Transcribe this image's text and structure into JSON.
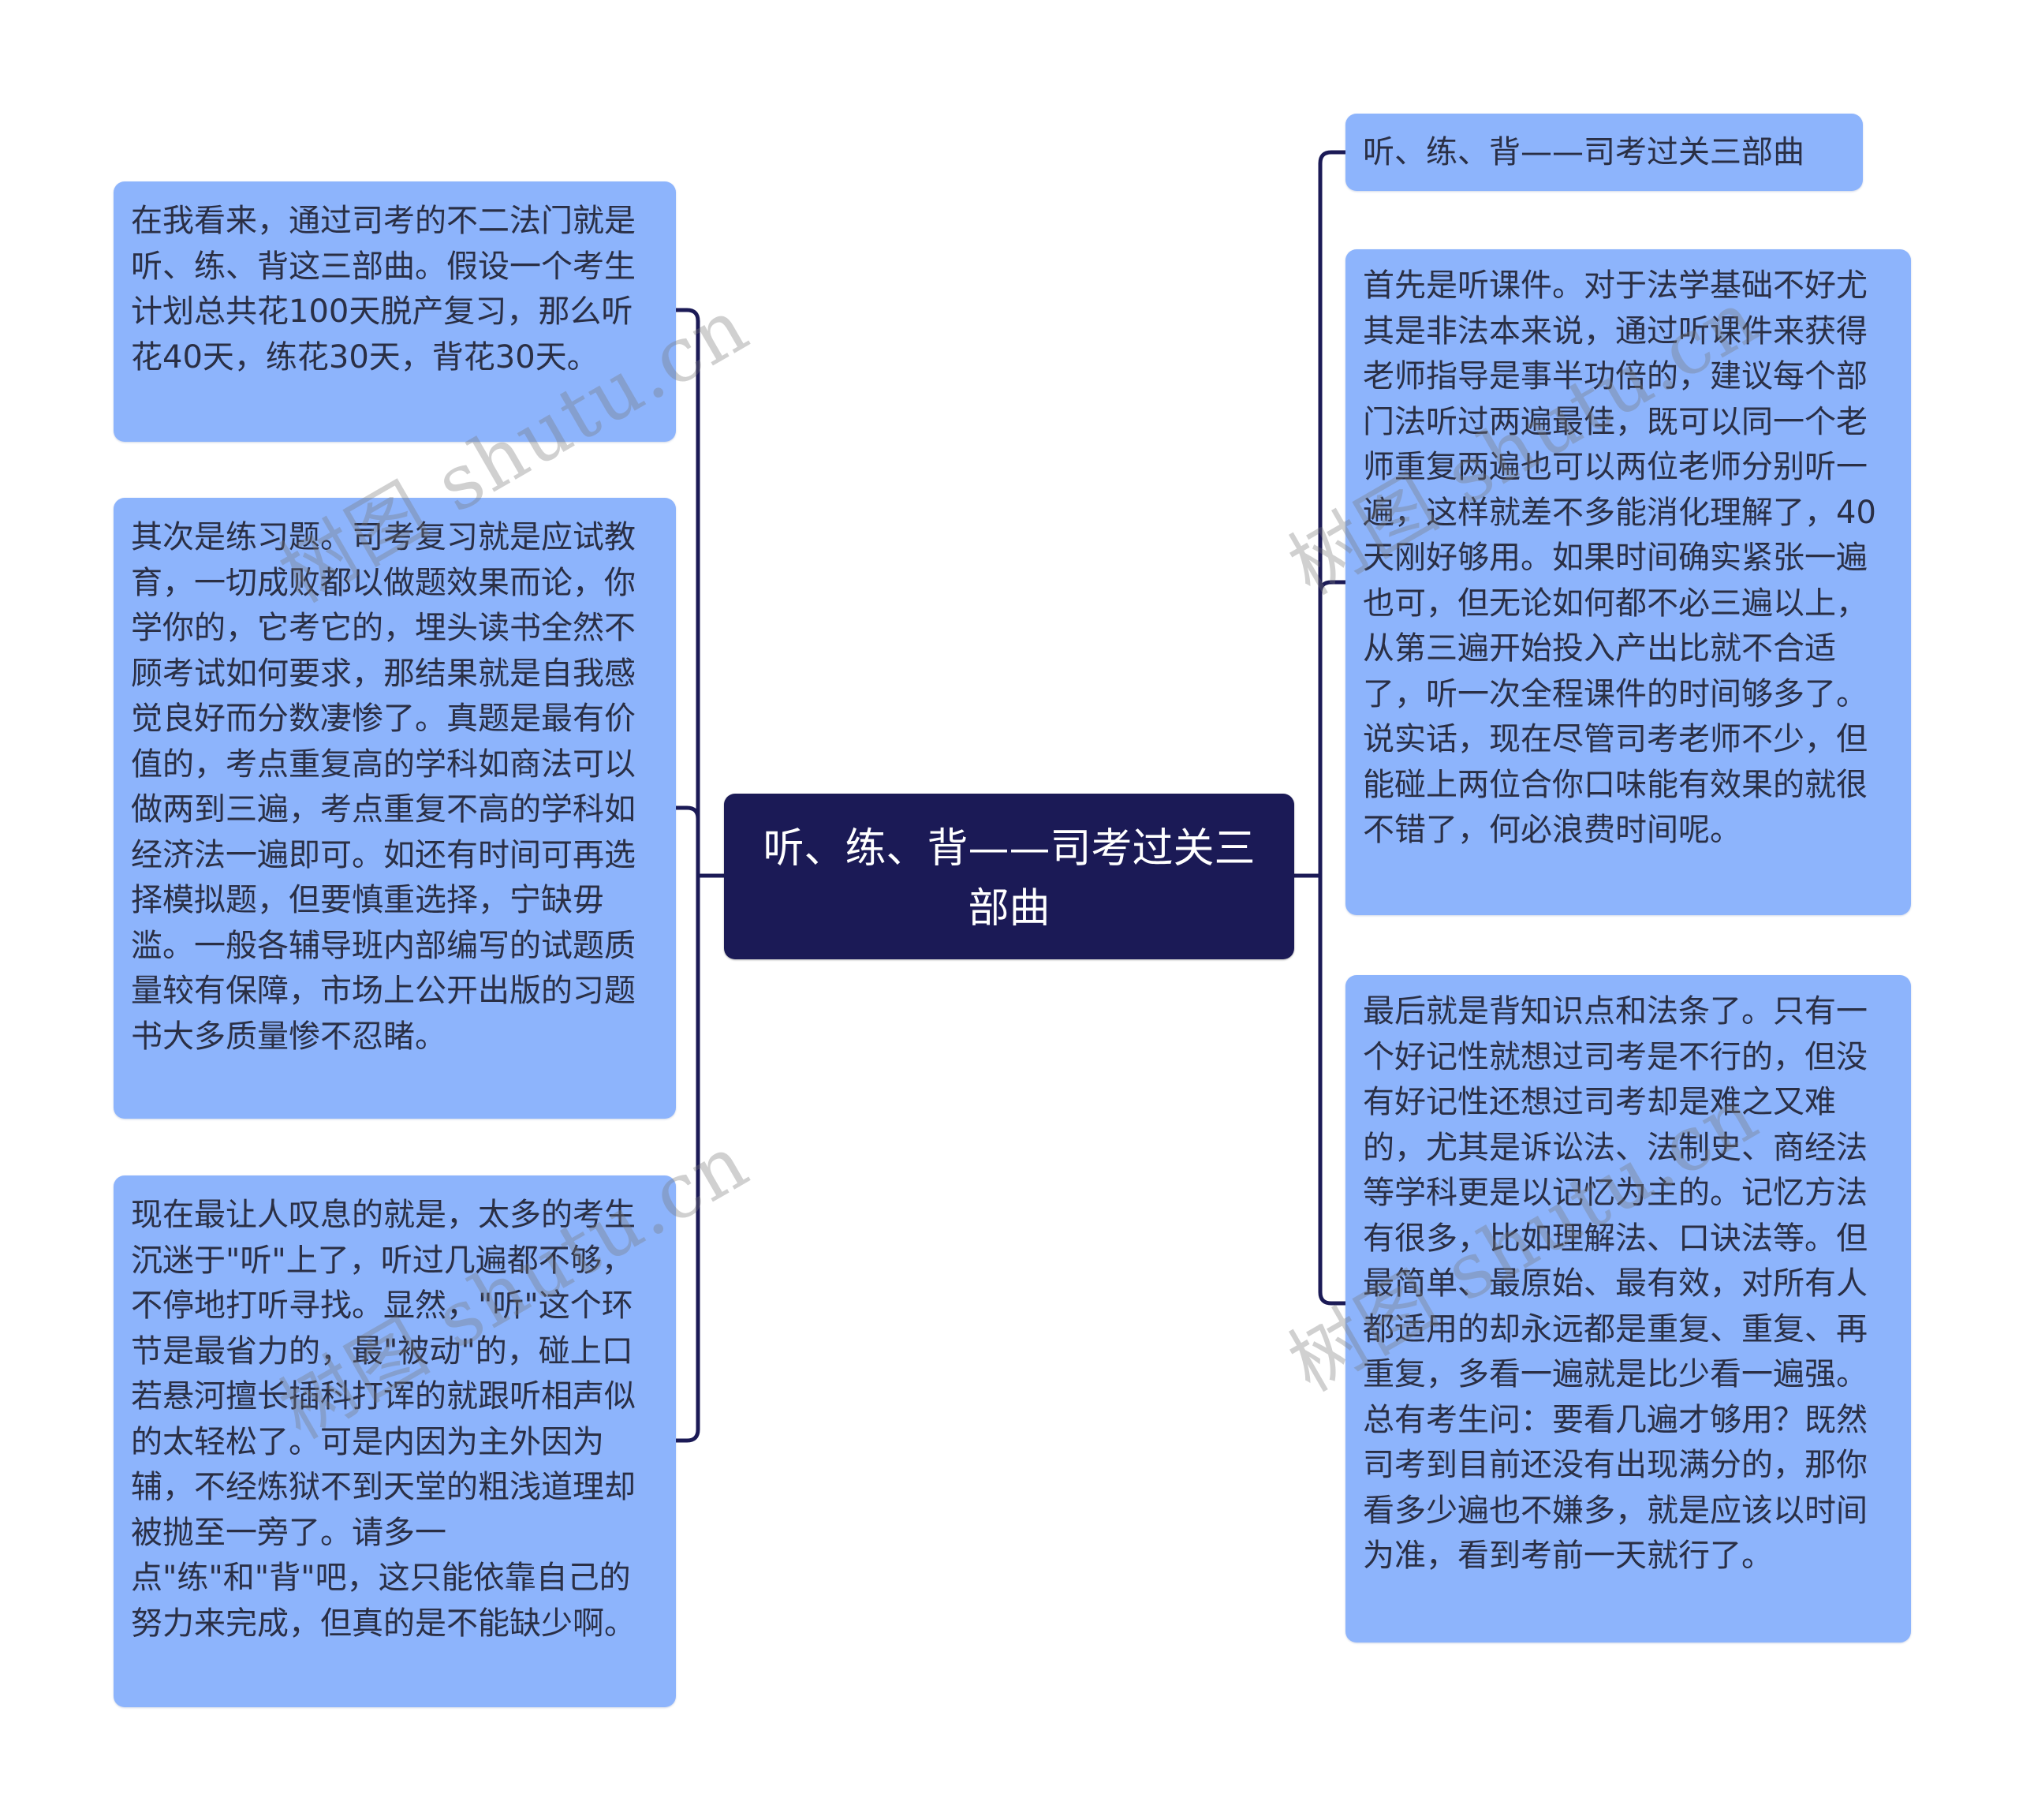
{
  "mindmap": {
    "root": {
      "text": "听、练、背——司考过关三部曲"
    },
    "left_nodes": [
      {
        "text": "在我看来，通过司考的不二法门就是听、练、背这三部曲。假设一个考生计划总共花100天脱产复习，那么听花40天，练花30天，背花30天。"
      },
      {
        "text": "其次是练习题。司考复习就是应试教育，一切成败都以做题效果而论，你学你的，它考它的，埋头读书全然不顾考试如何要求，那结果就是自我感觉良好而分数凄惨了。真题是最有价值的，考点重复高的学科如商法可以做两到三遍，考点重复不高的学科如经济法一遍即可。如还有时间可再选择模拟题，但要慎重选择，宁缺毋滥。一般各辅导班内部编写的试题质量较有保障，市场上公开出版的习题书大多质量惨不忍睹。"
      },
      {
        "text": "现在最让人叹息的就是，太多的考生沉迷于\"听\"上了，听过几遍都不够，不停地打听寻找。显然，\"听\"这个环节是最省力的，最\"被动\"的，碰上口若悬河擅长插科打诨的就跟听相声似的太轻松了。可是内因为主外因为辅，不经炼狱不到天堂的粗浅道理却被抛至一旁了。请多一点\"练\"和\"背\"吧，这只能依靠自己的努力来完成，但真的是不能缺少啊。"
      }
    ],
    "right_nodes": [
      {
        "text": "听、练、背——司考过关三部曲"
      },
      {
        "text": "首先是听课件。对于法学基础不好尤其是非法本来说，通过听课件来获得老师指导是事半功倍的，建议每个部门法听过两遍最佳，既可以同一个老师重复两遍也可以两位老师分别听一遍，这样就差不多能消化理解了，40天刚好够用。如果时间确实紧张一遍也可，但无论如何都不必三遍以上，从第三遍开始投入产出比就不合适了，听一次全程课件的时间够多了。说实话，现在尽管司考老师不少，但能碰上两位合你口味能有效果的就很不错了，何必浪费时间呢。"
      },
      {
        "text": "最后就是背知识点和法条了。只有一个好记性就想过司考是不行的，但没有好记性还想过司考却是难之又难的，尤其是诉讼法、法制史、商经法等学科更是以记忆为主的。记忆方法有很多，比如理解法、口诀法等。但最简单、最原始、最有效，对所有人都适用的却永远都是重复、重复、再重复，多看一遍就是比少看一遍强。总有考生问：要看几遍才够用？既然司考到目前还没有出现满分的，那你看多少遍也不嫌多，就是应该以时间为准，看到考前一天就行了。"
      }
    ]
  },
  "watermark": {
    "text": "树图 shutu.cn"
  },
  "colors": {
    "root_bg": "#1b1a56",
    "node_bg": "#8db4fc",
    "line": "#1b1a56",
    "node_text": "#2a2f45",
    "root_text": "#ffffff"
  }
}
